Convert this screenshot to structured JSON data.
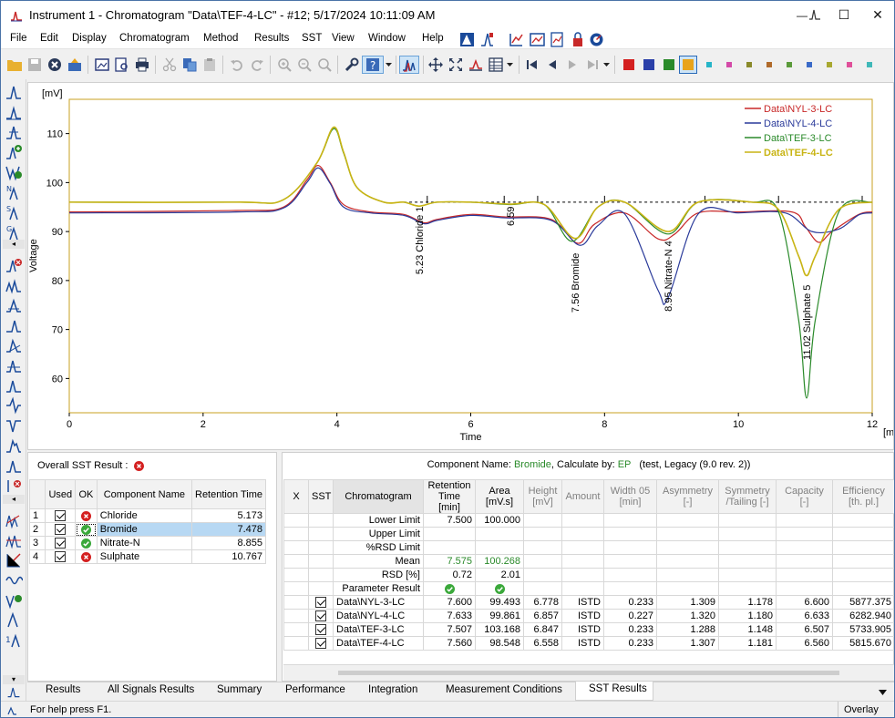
{
  "window": {
    "title": "Instrument 1 - Chromatogram \"Data\\TEF-4-LC\" - #12;   5/17/2024    10:11:09 AM",
    "minimize": "—",
    "maximize": "☐",
    "close": "✕"
  },
  "menu": [
    "File",
    "Edit",
    "Display",
    "Chromatogram",
    "Method",
    "Results",
    "SST",
    "View",
    "Window",
    "Help"
  ],
  "palette": {
    "swatches_large": [
      "#d42020",
      "#2a3fa8",
      "#2a8a2a",
      "#e8a31a"
    ],
    "swatches_small": [
      "#26b5c8",
      "#d44aa8",
      "#8a8a2a",
      "#b06a2a",
      "#5a9a3a",
      "#3a6ac8",
      "#a8a830",
      "#e0509a",
      "#40b8b8"
    ]
  },
  "chart_data": {
    "type": "line",
    "ylabel": "Voltage",
    "yunit": "[mV]",
    "xlabel": "Time",
    "xunit": "[min]",
    "xlim": [
      0,
      12
    ],
    "ylim": [
      53,
      117
    ],
    "xticks": [
      0,
      2,
      4,
      6,
      8,
      10,
      12
    ],
    "yticks": [
      60,
      70,
      80,
      90,
      100,
      110
    ],
    "series": [
      {
        "name": "Data\\NYL-3-LC",
        "color": "#c82828",
        "bold": false,
        "x": [
          0,
          2.5,
          3.2,
          3.55,
          3.72,
          3.9,
          4.1,
          4.5,
          5.0,
          5.3,
          5.5,
          6.0,
          6.5,
          7.2,
          7.6,
          7.85,
          8.3,
          8.8,
          9.05,
          9.4,
          10.0,
          10.8,
          11.0,
          11.2,
          11.4,
          11.8,
          12.0
        ],
        "y": [
          94,
          94.3,
          95,
          100.5,
          103.5,
          100,
          95.5,
          94,
          93.5,
          91.8,
          92.5,
          93.5,
          93,
          92.5,
          87.6,
          91.5,
          93.8,
          88.5,
          89.5,
          93.8,
          94,
          94,
          91,
          87.8,
          90,
          93.5,
          94
        ]
      },
      {
        "name": "Data\\NYL-4-LC",
        "color": "#2a3a9a",
        "bold": false,
        "x": [
          0,
          2.5,
          3.2,
          3.55,
          3.72,
          3.9,
          4.1,
          4.5,
          5.0,
          5.3,
          5.5,
          6.0,
          6.5,
          7.2,
          7.63,
          7.9,
          8.3,
          8.8,
          8.95,
          9.4,
          10.0,
          10.7,
          11.1,
          11.5,
          11.8,
          12.0
        ],
        "y": [
          93.8,
          94,
          94.8,
          100,
          103,
          99.8,
          95,
          93.8,
          93.3,
          91.6,
          92.3,
          93.3,
          92.8,
          92.3,
          87.2,
          91.2,
          93.6,
          78,
          76.5,
          93.6,
          93.8,
          93.8,
          90,
          90.5,
          93.4,
          93.8
        ]
      },
      {
        "name": "Data\\TEF-3-LC",
        "color": "#2a8a2a",
        "bold": false,
        "x": [
          0,
          2.5,
          3.2,
          3.7,
          3.95,
          4.1,
          4.3,
          4.7,
          5.0,
          5.23,
          5.5,
          6.0,
          6.6,
          7.1,
          7.51,
          7.9,
          8.3,
          8.95,
          9.4,
          10.2,
          10.6,
          10.9,
          11.02,
          11.15,
          11.5,
          12.0
        ],
        "y": [
          96,
          96,
          96.5,
          104,
          111,
          106,
          99,
          96,
          96,
          95.2,
          96,
          96,
          95.5,
          95.5,
          88,
          95,
          96,
          89.5,
          96,
          96,
          94,
          72,
          56,
          72,
          94,
          96
        ]
      },
      {
        "name": "Data\\TEF-4-LC",
        "color": "#c8b414",
        "bold": true,
        "x": [
          0,
          2.5,
          3.2,
          3.7,
          3.95,
          4.1,
          4.3,
          4.7,
          5.0,
          5.23,
          5.5,
          6.0,
          6.59,
          7.1,
          7.56,
          7.9,
          8.3,
          8.95,
          9.4,
          10.2,
          10.6,
          10.9,
          11.02,
          11.15,
          11.5,
          12.0
        ],
        "y": [
          96,
          96,
          96.5,
          104,
          111.3,
          106.2,
          99,
          96,
          96,
          95.2,
          96,
          96,
          95.6,
          95.5,
          88.6,
          95,
          96,
          90,
          96,
          96,
          94.5,
          85,
          81,
          85,
          94.5,
          96
        ]
      }
    ],
    "peak_labels": [
      {
        "text": "5.23 Chloride   1",
        "x": 5.23,
        "y": 95.5
      },
      {
        "text": "6.59",
        "x": 6.59,
        "y": 95.5
      },
      {
        "text": "7.56 Bromide",
        "x": 7.56,
        "y": 86
      },
      {
        "text": "8.95 Nitrate-N   4",
        "x": 8.95,
        "y": 88.5
      },
      {
        "text": "11.02 Sulphate   5",
        "x": 11.02,
        "y": 79.5
      }
    ],
    "baseline": {
      "x": [
        5.0,
        12.0
      ],
      "y": [
        96,
        96
      ]
    },
    "markers_x": [
      5.35,
      6.5,
      7.0,
      8.0,
      9.5,
      10.6,
      11.85
    ]
  },
  "sst": {
    "overall_label": "Overall SST Result :",
    "overall_ok": false,
    "left_headers": [
      "",
      "Used",
      "OK",
      "Component Name",
      "Retention Time"
    ],
    "left_rows": [
      {
        "idx": "1",
        "ok": false,
        "name": "Chloride",
        "rt": "5.173",
        "selected": false
      },
      {
        "idx": "2",
        "ok": true,
        "name": "Bromide",
        "rt": "7.478",
        "selected": true
      },
      {
        "idx": "3",
        "ok": true,
        "name": "Nitrate-N",
        "rt": "8.855",
        "selected": false
      },
      {
        "idx": "4",
        "ok": false,
        "name": "Sulphate",
        "rt": "10.767",
        "selected": false
      }
    ],
    "component_prefix": "Component Name:",
    "component_name": "Bromide",
    "calc_prefix": ", Calculate by:",
    "calc_by": "EP",
    "calc_suffix": "(test, Legacy (9.0 rev. 2))",
    "right_headers": [
      "X",
      "SST",
      "Chromatogram",
      "Retention Time [min]",
      "Area [mV.s]",
      "Height [mV]",
      "Amount",
      "Width 05 [min]",
      "Asymmetry [-]",
      "Symmetry /Tailing [-]",
      "Capacity [-]",
      "Efficiency [th. pl.]"
    ],
    "limit_rows": [
      {
        "label": "Lower Limit",
        "rt": "7.500",
        "area": "100.000",
        "color": "#000"
      },
      {
        "label": "Upper Limit",
        "rt": "",
        "area": "",
        "color": "#000"
      },
      {
        "label": "%RSD Limit",
        "rt": "",
        "area": "",
        "color": "#000"
      },
      {
        "label": "Mean",
        "rt": "7.575",
        "area": "100.268",
        "color": "#2a8a2a"
      },
      {
        "label": "RSD [%]",
        "rt": "0.72",
        "area": "2.01",
        "color": "#000"
      }
    ],
    "param_result_label": "Parameter Result",
    "data_rows": [
      {
        "chrom": "Data\\NYL-3-LC",
        "rt": "7.600",
        "area": "99.493",
        "height": "6.778",
        "amount": "ISTD",
        "width": "0.233",
        "asym": "1.309",
        "sym": "1.178",
        "cap": "6.600",
        "eff": "5877.375",
        "bold": false
      },
      {
        "chrom": "Data\\NYL-4-LC",
        "rt": "7.633",
        "area": "99.861",
        "height": "6.857",
        "amount": "ISTD",
        "width": "0.227",
        "asym": "1.320",
        "sym": "1.180",
        "cap": "6.633",
        "eff": "6282.940",
        "bold": false
      },
      {
        "chrom": "Data\\TEF-3-LC",
        "rt": "7.507",
        "area": "103.168",
        "height": "6.847",
        "amount": "ISTD",
        "width": "0.233",
        "asym": "1.288",
        "sym": "1.148",
        "cap": "6.507",
        "eff": "5733.905",
        "bold": false
      },
      {
        "chrom": "Data\\TEF-4-LC",
        "rt": "7.560",
        "area": "98.548",
        "height": "6.558",
        "amount": "ISTD",
        "width": "0.233",
        "asym": "1.307",
        "sym": "1.181",
        "cap": "6.560",
        "eff": "5815.670",
        "bold": true
      }
    ]
  },
  "tabs": [
    {
      "label": "Results",
      "active": false
    },
    {
      "label": "All Signals Results",
      "active": false
    },
    {
      "label": "Summary",
      "active": false
    },
    {
      "label": "Performance",
      "active": false
    },
    {
      "label": "Integration",
      "active": false
    },
    {
      "label": "Measurement Conditions",
      "active": false
    },
    {
      "label": "SST Results",
      "active": true
    }
  ],
  "status": {
    "help": "For help press F1.",
    "mode": "Overlay"
  }
}
